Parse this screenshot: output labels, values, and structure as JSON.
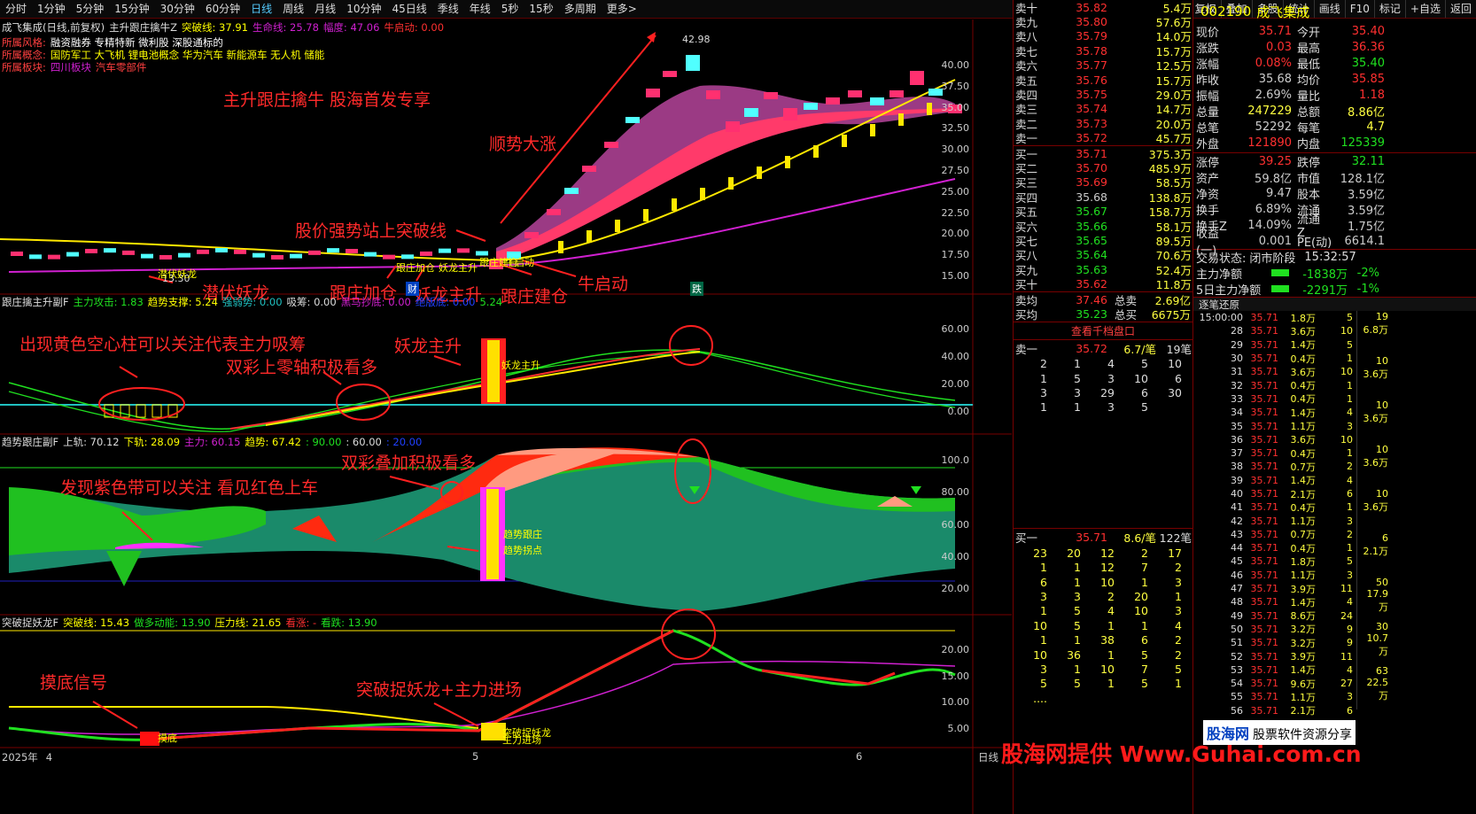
{
  "topbar": {
    "timeframes": [
      "分时",
      "1分钟",
      "5分钟",
      "15分钟",
      "30分钟",
      "60分钟",
      "日线",
      "周线",
      "月线",
      "10分钟",
      "45日线",
      "季线",
      "年线",
      "5秒",
      "15秒",
      "多周期",
      "更多>"
    ],
    "right": [
      "复权",
      "叠加",
      "多股",
      "统计",
      "画线",
      "F10",
      "标记",
      "+自选",
      "返回"
    ]
  },
  "panel1": {
    "header": [
      "成飞集成(日线,前复权)",
      "主升跟庄擒牛Z",
      "突破线: 37.91",
      "生命线: 25.78",
      "幅度: 47.06",
      "牛启动: 0.00"
    ],
    "style_label": "所属风格:",
    "style": "融资融券 专精特新 微利股 深股通标的",
    "concept_label": "所属概念:",
    "concept": "国防军工 大飞机 锂电池概念 华为汽车 新能源车 无人机 储能",
    "board_label": "所属板块:",
    "board": "四川板块",
    "board2": "汽车零部件",
    "price_axis": [
      "40.00",
      "37.50",
      "35.00",
      "32.50",
      "30.00",
      "27.50",
      "25.00",
      "22.50",
      "20.00",
      "17.50",
      "15.00"
    ],
    "high_label": "42.98",
    "low_label": "13.30"
  },
  "ann": {
    "a1": "主升跟庄擒牛 股海首发专享",
    "a2": "顺势大涨",
    "a3": "股价强势站上突破线",
    "a4": "潜伏妖龙",
    "a5": "跟庄加仓",
    "a6": "妖龙主升",
    "a7": "跟庄建仓",
    "a8": "牛启动",
    "s1": "潜伏妖龙",
    "s2": "跟庄加仓",
    "s3": "妖龙主升",
    "s4": "跟庄建仓",
    "s5": "牛启动",
    "cai": "财",
    "die": "跌",
    "b1": "出现黄色空心柱可以关注代表主力吸筹",
    "b2": "双彩上零轴积极看多",
    "b3": "妖龙主升",
    "b4": "妖龙主升",
    "c1": "双彩叠加积极看多",
    "c2": "发现紫色带可以关注 看见红色上车",
    "c3": "趋势跟庄",
    "c4": "趋势拐点",
    "d1": "摸底信号",
    "d2": "突破捉妖龙+主力进场",
    "d3": "摸底",
    "d4": "突破捉妖龙",
    "d5": "主力进场"
  },
  "panel2": {
    "header": [
      "跟庄擒主升副F",
      "主力攻击: 1.83",
      "趋势支撑: 5.24",
      "强弱势: 0.00",
      "吸筹: 0.00",
      "黑马抄底: 0.00",
      "绝版底: 0.00",
      "5.24"
    ],
    "axis": [
      "60.00",
      "40.00",
      "20.00",
      "0.00"
    ]
  },
  "panel3": {
    "header": [
      "趋势跟庄副F",
      "上轨: 70.12",
      "下轨: 28.09",
      "主力: 60.15",
      "趋势: 67.42",
      ": 90.00",
      ": 60.00",
      ": 20.00"
    ],
    "axis": [
      "100.0",
      "80.00",
      "60.00",
      "40.00",
      "20.00"
    ]
  },
  "panel4": {
    "header": [
      "突破捉妖龙F",
      "突破线: 15.43",
      "做多动能: 13.90",
      "压力线: 21.65",
      "看涨: -",
      "看跌: 13.90"
    ],
    "axis": [
      "20.00",
      "15.00",
      "10.00",
      "5.00"
    ]
  },
  "xaxis": {
    "year": "2025年",
    "m4": "4",
    "m5": "5",
    "m6": "6",
    "period": "日线"
  },
  "orderbook": {
    "asks": [
      [
        "卖十",
        "¥",
        "35.82",
        "5.4万"
      ],
      [
        "卖九",
        "",
        "35.80",
        "57.6万"
      ],
      [
        "卖八",
        "",
        "35.79",
        "14.0万"
      ],
      [
        "卖七",
        "",
        "35.78",
        "15.7万"
      ],
      [
        "卖六",
        "",
        "35.77",
        "12.5万"
      ],
      [
        "卖五",
        "",
        "35.76",
        "15.7万"
      ],
      [
        "卖四",
        "",
        "35.75",
        "29.0万"
      ],
      [
        "卖三",
        "",
        "35.74",
        "14.7万"
      ],
      [
        "卖二",
        "",
        "35.73",
        "20.0万"
      ],
      [
        "卖一",
        "",
        "35.72",
        "45.7万"
      ]
    ],
    "bids": [
      [
        "买一",
        "35.71",
        "375.3万"
      ],
      [
        "买二",
        "35.70",
        "485.9万"
      ],
      [
        "买三",
        "35.69",
        "58.5万"
      ],
      [
        "买四",
        "35.68",
        "138.8万"
      ],
      [
        "买五",
        "35.67",
        "158.7万"
      ],
      [
        "买六",
        "35.66",
        "58.1万"
      ],
      [
        "买七",
        "35.65",
        "89.5万"
      ],
      [
        "买八",
        "35.64",
        "70.6万"
      ],
      [
        "买九",
        "35.63",
        "52.4万"
      ],
      [
        "买十",
        "35.62",
        "11.8万"
      ]
    ],
    "avg_ask_l": "卖均",
    "avg_ask": "37.46",
    "total_ask_l": "总卖",
    "total_ask": "2.69亿",
    "avg_bid_l": "买均",
    "avg_bid": "35.23",
    "total_bid_l": "总买",
    "total_bid": "6675万",
    "tenlevel": "查看千档盘口",
    "ask1_l": "卖一",
    "ask1_p": "35.72",
    "ask1_r": "6.7/笔",
    "ask1_c": "19笔",
    "ask_q": [
      [
        "2",
        "1",
        "4",
        "5",
        "10"
      ],
      [
        "1",
        "5",
        "3",
        "10",
        "6"
      ],
      [
        "3",
        "3",
        "29",
        "6",
        "30"
      ],
      [
        "1",
        "1",
        "3",
        "5",
        ""
      ]
    ],
    "bid1_l": "买一",
    "bid1_p": "35.71",
    "bid1_r": "8.6/笔",
    "bid1_c": "122笔",
    "bid_q": [
      [
        "23",
        "20",
        "12",
        "2",
        "17"
      ],
      [
        "1",
        "1",
        "12",
        "7",
        "2"
      ],
      [
        "6",
        "1",
        "10",
        "1",
        "3"
      ],
      [
        "3",
        "3",
        "2",
        "20",
        "1"
      ],
      [
        "1",
        "5",
        "4",
        "10",
        "3"
      ],
      [
        "10",
        "5",
        "1",
        "1",
        "4"
      ],
      [
        "1",
        "1",
        "38",
        "6",
        "2"
      ],
      [
        "10",
        "36",
        "1",
        "5",
        "2"
      ],
      [
        "3",
        "1",
        "10",
        "7",
        "5"
      ],
      [
        "5",
        "5",
        "1",
        "5",
        "1"
      ],
      [
        "....",
        "",
        "",
        "",
        ""
      ]
    ]
  },
  "info": {
    "code": "002190",
    "name": "成飞集成",
    "rows": [
      [
        "现价",
        "35.71",
        "今开",
        "35.40"
      ],
      [
        "涨跌",
        "0.03",
        "最高",
        "36.36"
      ],
      [
        "涨幅",
        "0.08%",
        "最低",
        "35.40"
      ],
      [
        "昨收",
        "35.68",
        "均价",
        "35.85"
      ],
      [
        "振幅",
        "2.69%",
        "量比",
        "1.18"
      ],
      [
        "总量",
        "247229",
        "总额",
        "8.86亿"
      ],
      [
        "总笔",
        "52292",
        "每笔",
        "4.7"
      ],
      [
        "外盘",
        "121890",
        "内盘",
        "125339"
      ]
    ],
    "rows2": [
      [
        "涨停",
        "39.25",
        "跌停",
        "32.11"
      ],
      [
        "资产",
        "59.8亿",
        "市值",
        "128.1亿"
      ],
      [
        "净资",
        "9.47",
        "股本",
        "3.59亿"
      ],
      [
        "换手",
        "6.89%",
        "流通",
        "3.59亿"
      ],
      [
        "换手Z",
        "14.09%",
        "流通Z",
        "1.75亿"
      ],
      [
        "收益(一)",
        "0.001",
        "PE(动)",
        "6614.1"
      ]
    ],
    "status_l": "交易状态:",
    "status": "闭市阶段",
    "time": "15:32:57",
    "flow1_l": "主力净额",
    "flow1": "-1838万",
    "flow1p": "-2%",
    "flow2_l": "5日主力净额",
    "flow2": "-2291万",
    "flow2p": "-1%",
    "tick_title": "逐笔还原",
    "ticks": [
      [
        "15:00:00",
        "35.71",
        "1.8万",
        "5"
      ],
      [
        "28",
        "35.71",
        "3.6万",
        "10"
      ],
      [
        "29",
        "35.71",
        "1.4万",
        "5"
      ],
      [
        "30",
        "35.71",
        "0.4万",
        "1"
      ],
      [
        "31",
        "35.71",
        "3.6万",
        "10"
      ],
      [
        "32",
        "35.71",
        "0.4万",
        "1"
      ],
      [
        "33",
        "35.71",
        "0.4万",
        "1"
      ],
      [
        "34",
        "35.71",
        "1.4万",
        "4"
      ],
      [
        "35",
        "35.71",
        "1.1万",
        "3"
      ],
      [
        "36",
        "35.71",
        "3.6万",
        "10"
      ],
      [
        "37",
        "35.71",
        "0.4万",
        "1"
      ],
      [
        "38",
        "35.71",
        "0.7万",
        "2"
      ],
      [
        "39",
        "35.71",
        "1.4万",
        "4"
      ],
      [
        "40",
        "35.71",
        "2.1万",
        "6"
      ],
      [
        "41",
        "35.71",
        "0.4万",
        "1"
      ],
      [
        "42",
        "35.71",
        "1.1万",
        "3"
      ],
      [
        "43",
        "35.71",
        "0.7万",
        "2"
      ],
      [
        "44",
        "35.71",
        "0.4万",
        "1"
      ],
      [
        "45",
        "35.71",
        "1.8万",
        "5"
      ],
      [
        "46",
        "35.71",
        "1.1万",
        "3"
      ],
      [
        "47",
        "35.71",
        "3.9万",
        "11"
      ],
      [
        "48",
        "35.71",
        "1.4万",
        "4"
      ],
      [
        "49",
        "35.71",
        "8.6万",
        "24"
      ],
      [
        "50",
        "35.71",
        "3.2万",
        "9"
      ],
      [
        "51",
        "35.71",
        "3.2万",
        "9"
      ],
      [
        "52",
        "35.71",
        "3.9万",
        "11"
      ],
      [
        "53",
        "35.71",
        "1.4万",
        "4"
      ],
      [
        "54",
        "35.71",
        "9.6万",
        "27"
      ],
      [
        "55",
        "35.71",
        "1.1万",
        "3"
      ],
      [
        "56",
        "35.71",
        "2.1万",
        "6"
      ]
    ],
    "tick_groups": [
      [
        "19",
        "6.8万"
      ],
      [
        "10",
        "3.6万"
      ],
      [
        "10",
        "3.6万"
      ],
      [
        "10",
        "3.6万"
      ],
      [
        "10",
        "3.6万"
      ],
      [
        "6",
        "2.1万"
      ],
      [
        "50",
        "17.9万"
      ],
      [
        "30",
        "10.7万"
      ],
      [
        "63",
        "22.5万"
      ]
    ]
  },
  "banner": "股海网提供 Www.Guhai.com.cn",
  "logo": "股海网",
  "logo2": "股票软件资源分享",
  "colors": {
    "up": "#ff3030",
    "down": "#20e020",
    "bg": "#000000",
    "grid": "#5a0000"
  }
}
